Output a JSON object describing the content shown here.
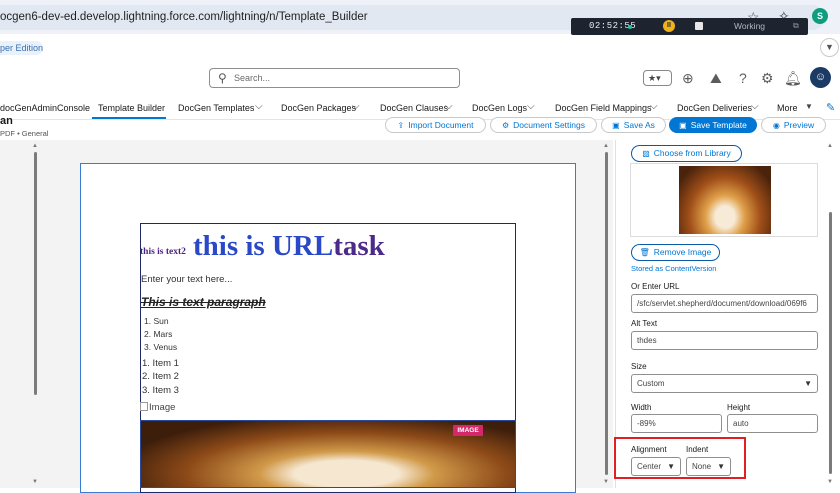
{
  "browser": {
    "url": "ocgen6-dev-ed.develop.lightning.force.com/lightning/n/Template_Builder",
    "profile_initial": "S"
  },
  "recorder": {
    "time": "02:52:55",
    "status": "Working"
  },
  "edition": "per Edition",
  "header": {
    "search_placeholder": "Search..."
  },
  "nav": {
    "items": [
      {
        "label": "docGenAdminConsole"
      },
      {
        "label": "Template Builder"
      },
      {
        "label": "DocGen Templates"
      },
      {
        "label": "DocGen Packages"
      },
      {
        "label": "DocGen Clauses"
      },
      {
        "label": "DocGen Logs"
      },
      {
        "label": "DocGen Field Mappings"
      },
      {
        "label": "DocGen Deliveries"
      },
      {
        "label": "More"
      }
    ]
  },
  "page": {
    "title": "an",
    "subtitle": "PDF • General"
  },
  "toolbar": {
    "import": "Import Document",
    "settings": "Document Settings",
    "save_as": "Save As",
    "save_template": "Save Template",
    "preview": "Preview"
  },
  "document": {
    "heading_small": "this is text2",
    "heading_big_1": "this is URL",
    "heading_big_2": "task",
    "text_placeholder": "Enter your text here...",
    "paragraph": "This is text paragraph",
    "list1": [
      "1. Sun",
      "2. Mars",
      "3. Venus"
    ],
    "list2": [
      "1. Item 1",
      "2. Item 2",
      "3. Item 3"
    ],
    "broken_image_alt": "Image",
    "image_badge": "IMAGE"
  },
  "panel": {
    "choose_library": "Choose from Library",
    "remove_image": "Remove Image",
    "stored_as": "Stored as ContentVersion",
    "url_label": "Or Enter URL",
    "url_value": "/sfc/servlet.shepherd/document/download/069f6",
    "alt_label": "Alt Text",
    "alt_value": "thdes",
    "size_label": "Size",
    "size_value": "Custom",
    "width_label": "Width",
    "width_value": "-89%",
    "height_label": "Height",
    "height_value": "auto",
    "alignment_label": "Alignment",
    "alignment_value": "Center",
    "indent_label": "Indent",
    "indent_value": "None"
  },
  "colors": {
    "brand": "#0176d3",
    "highlight": "#e01e24",
    "badge": "#d4286b"
  }
}
